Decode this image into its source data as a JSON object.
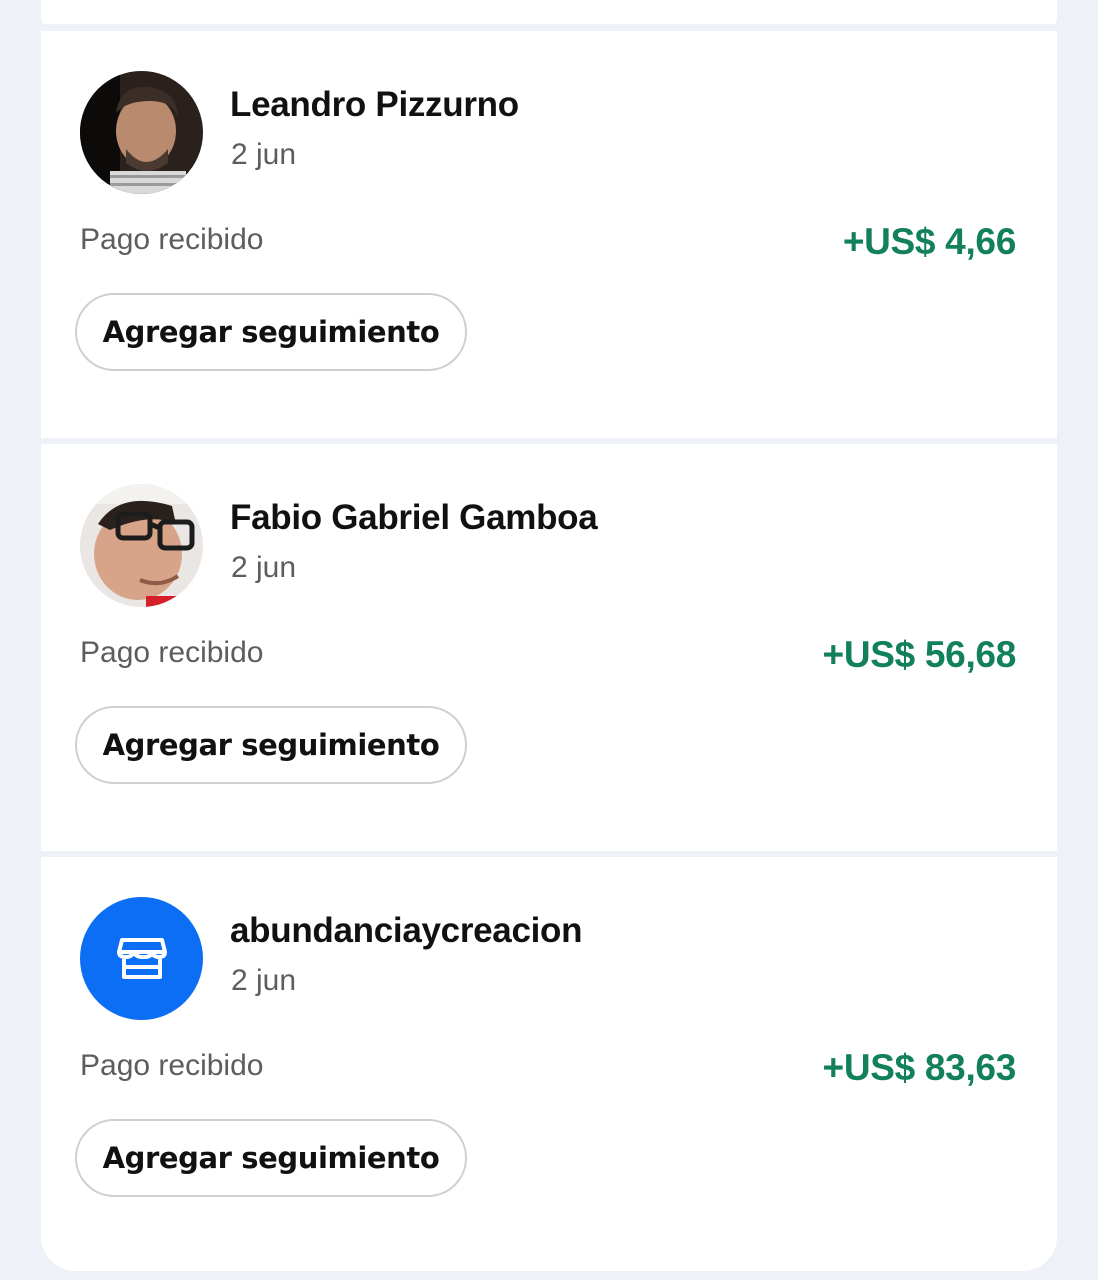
{
  "accent_color": "#12805a",
  "store_avatar_color": "#0b6ef5",
  "transactions": [
    {
      "name": "Leandro Pizzurno",
      "date": "2 jun",
      "status": "Pago recibido",
      "amount": "+US$ 4,66",
      "button_label": "Agregar seguimiento",
      "avatar": "person-photo"
    },
    {
      "name": "Fabio Gabriel Gamboa",
      "date": "2 jun",
      "status": "Pago recibido",
      "amount": "+US$ 56,68",
      "button_label": "Agregar seguimiento",
      "avatar": "person-photo"
    },
    {
      "name": "abundanciaycreacion",
      "date": "2 jun",
      "status": "Pago recibido",
      "amount": "+US$ 83,63",
      "button_label": "Agregar seguimiento",
      "avatar": "store-icon"
    }
  ]
}
